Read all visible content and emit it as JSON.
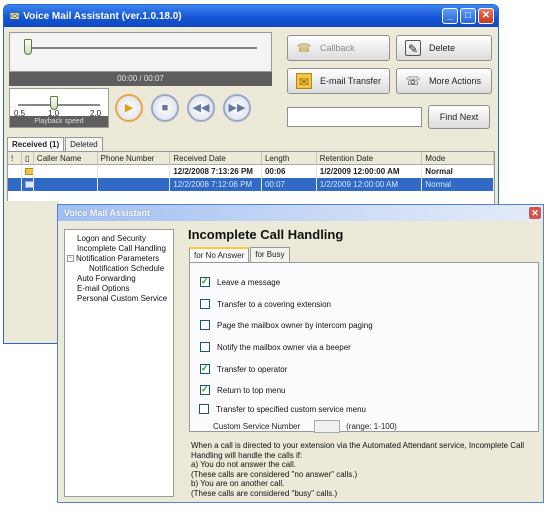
{
  "main_window": {
    "title": "Voice Mail Assistant (ver.1.0.18.0)",
    "title_buttons": [
      "minimize",
      "maximize",
      "close"
    ],
    "player": {
      "time_display": "00:00  /  00:07",
      "speed_ticks": [
        "0.5",
        "1.0",
        "2.0"
      ],
      "speed_label": "Playback speed"
    },
    "actions": {
      "callback": "Callback",
      "delete": "Delete",
      "email_transfer": "E-mail Transfer",
      "more_actions": "More Actions",
      "find_next": "Find Next",
      "find_value": ""
    },
    "tabs": [
      {
        "label": "Received (1)",
        "active": true
      },
      {
        "label": "Deleted",
        "active": false
      }
    ],
    "table": {
      "columns": [
        "!",
        "",
        "Caller Name",
        "Phone Number",
        "Received Date",
        "Length",
        "Retention Date",
        "Mode"
      ],
      "rows": [
        {
          "flag": "",
          "icon": "envelope-closed",
          "caller": "",
          "phone": "",
          "received": "12/2/2008 7:13:26 PM",
          "length": "00:06",
          "retention": "1/2/2009 12:00:00 AM",
          "mode": "Normal",
          "style": "bold"
        },
        {
          "flag": "",
          "icon": "envelope-open",
          "caller": "",
          "phone": "",
          "received": "12/2/2008 7:12:06 PM",
          "length": "00:07",
          "retention": "1/2/2009 12:00:00 AM",
          "mode": "Normal",
          "style": "selected"
        }
      ]
    }
  },
  "dialog": {
    "title": "Voice Mail Assistant",
    "nav": [
      {
        "label": "Logon and Security",
        "level": 1,
        "expander": ""
      },
      {
        "label": "Incomplete Call Handling",
        "level": 1,
        "expander": ""
      },
      {
        "label": "Notification Parameters",
        "level": 0,
        "expander": "-"
      },
      {
        "label": "Notification Schedule",
        "level": 2,
        "expander": ""
      },
      {
        "label": "Auto Forwarding",
        "level": 1,
        "expander": ""
      },
      {
        "label": "E-mail Options",
        "level": 1,
        "expander": ""
      },
      {
        "label": "Personal Custom Service",
        "level": 1,
        "expander": ""
      }
    ],
    "heading": "Incomplete Call Handling",
    "tabs": [
      {
        "label": "for No Answer",
        "active": true
      },
      {
        "label": "for Busy",
        "active": false
      }
    ],
    "options": [
      {
        "label": "Leave a message",
        "checked": true
      },
      {
        "label": "Transfer to a covering extension",
        "checked": false
      },
      {
        "label": "Page the mailbox owner by intercom paging",
        "checked": false
      },
      {
        "label": "Notify the mailbox owner via a beeper",
        "checked": false
      },
      {
        "label": "Transfer to operator",
        "checked": true
      },
      {
        "label": "Return to top menu",
        "checked": true
      },
      {
        "label": "Transfer to specified custom service menu",
        "checked": false
      }
    ],
    "custom_service": {
      "label": "Custom Service Number",
      "value": "",
      "range": "(range: 1-100)"
    },
    "description": "When a call is directed to your extension via the Automated Attendant service, Incomplete Call Handling will handle the calls if:\na) You do not answer the call.\n   (These calls are considered \"no answer\" calls.)\nb) You are on another call.\n   (These calls are considered \"busy\" calls.)"
  }
}
